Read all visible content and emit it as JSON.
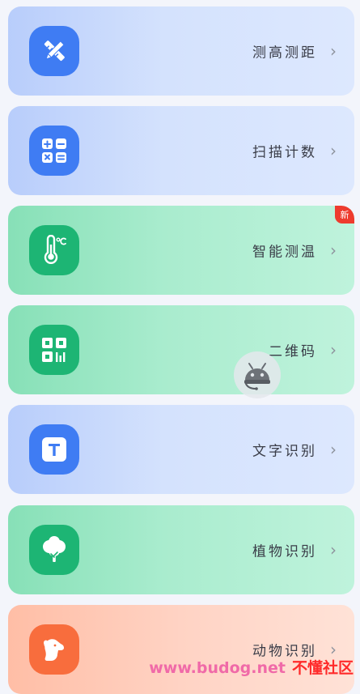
{
  "items": [
    {
      "id": "measure",
      "label": "测高测距",
      "icon": "ruler-pencil-icon",
      "theme": "blue"
    },
    {
      "id": "scan-count",
      "label": "扫描计数",
      "icon": "calculator-icon",
      "theme": "blue"
    },
    {
      "id": "temperature",
      "label": "智能测温",
      "icon": "thermometer-icon",
      "theme": "green",
      "badge": "新"
    },
    {
      "id": "qrcode",
      "label": "二维码",
      "icon": "qrcode-icon",
      "theme": "green"
    },
    {
      "id": "text-ocr",
      "label": "文字识别",
      "icon": "text-t-icon",
      "theme": "blue"
    },
    {
      "id": "plant",
      "label": "植物识别",
      "icon": "tree-icon",
      "theme": "green"
    },
    {
      "id": "animal",
      "label": "动物识别",
      "icon": "dog-icon",
      "theme": "orange"
    }
  ],
  "chevron": "›",
  "watermark": {
    "url": "www.budog.net",
    "site": "不懂社区"
  },
  "colors": {
    "blue_icon": "#3f7cf3",
    "green_icon": "#1db574",
    "orange_icon": "#f86d3d",
    "badge": "#ee3b2e"
  }
}
